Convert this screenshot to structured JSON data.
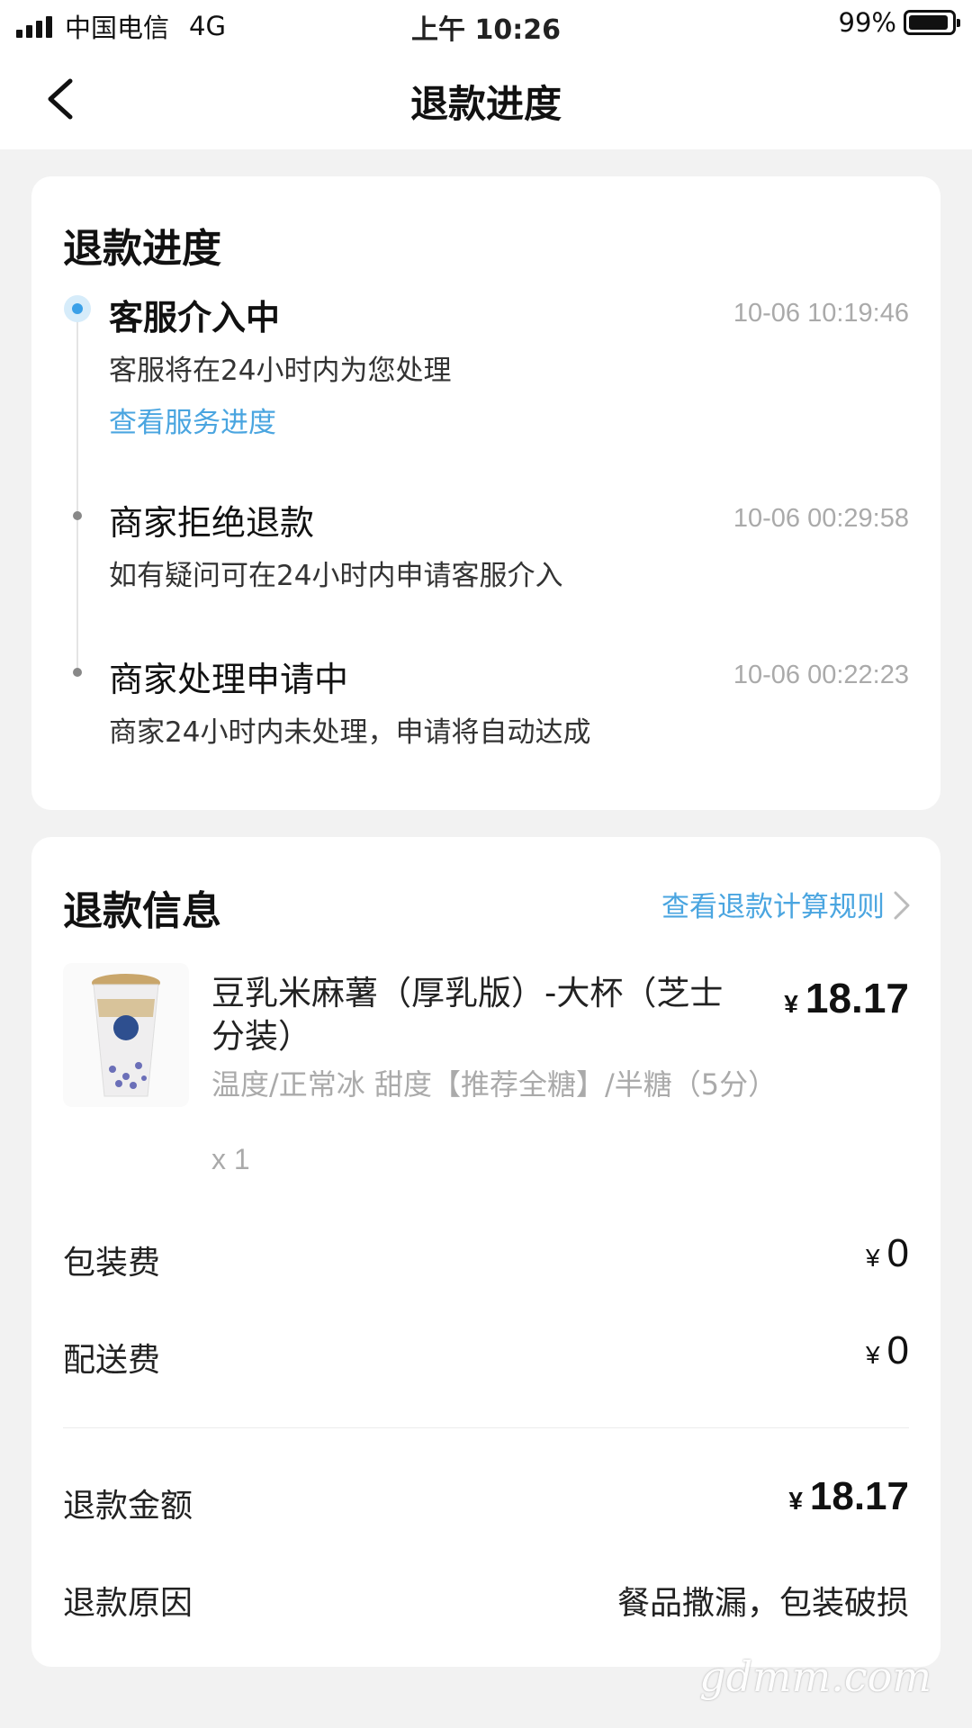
{
  "status_bar": {
    "carrier": "中国电信",
    "network": "4G",
    "time": "上午 10:26",
    "battery": "99%",
    "signal_bars": 4
  },
  "nav": {
    "title": "退款进度",
    "back_icon": "chevron-left-icon"
  },
  "progress": {
    "title": "退款进度",
    "steps": [
      {
        "title": "客服介入中",
        "time": "10-06 10:19:46",
        "desc": "客服将在24小时内为您处理",
        "link": "查看服务进度",
        "active": true
      },
      {
        "title": "商家拒绝退款",
        "time": "10-06 00:29:58",
        "desc": "如有疑问可在24小时内申请客服介入"
      },
      {
        "title": "商家处理申请中",
        "time": "10-06 00:22:23",
        "desc": "商家24小时内未处理，申请将自动达成"
      }
    ]
  },
  "refund_info": {
    "title": "退款信息",
    "rule_link": "查看退款计算规则",
    "product": {
      "name": "豆乳米麻薯（厚乳版）-大杯（芝士分装）",
      "price_symbol": "¥",
      "price": "18.17",
      "spec": "温度/正常冰 甜度【推荐全糖】/半糖（5分）",
      "qty": "x 1"
    },
    "packaging_label": "包装费",
    "packaging_value": "0",
    "delivery_label": "配送费",
    "delivery_value": "0",
    "amount_label": "退款金额",
    "amount_value": "18.17",
    "reason_label": "退款原因",
    "reason_value": "餐品撒漏，包装破损",
    "currency": "¥"
  },
  "watermark": "gdmm.com",
  "colors": {
    "accent": "#4aa5e0",
    "background": "#f2f2f2"
  }
}
